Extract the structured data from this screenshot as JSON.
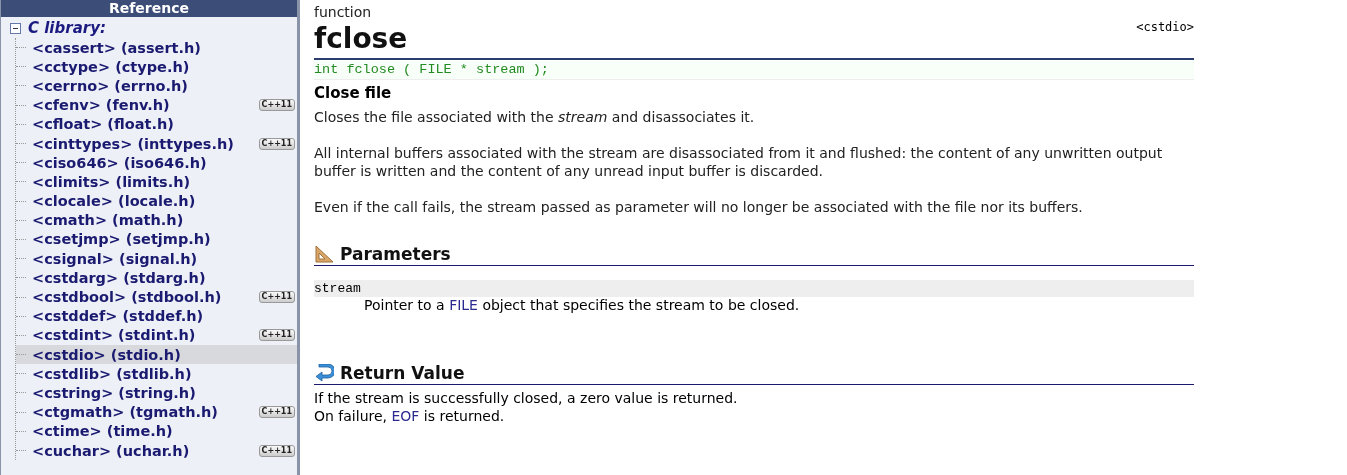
{
  "sidebar": {
    "header": "Reference",
    "section": {
      "label": "C library:",
      "expanded": true
    },
    "items": [
      {
        "label": "<cassert> (assert.h)",
        "selected": false
      },
      {
        "label": "<cctype> (ctype.h)",
        "selected": false
      },
      {
        "label": "<cerrno> (errno.h)",
        "selected": false
      },
      {
        "label": "<cfenv> (fenv.h)",
        "badge": "C++11",
        "selected": false
      },
      {
        "label": "<cfloat> (float.h)",
        "selected": false
      },
      {
        "label": "<cinttypes> (inttypes.h)",
        "badge": "C++11",
        "selected": false
      },
      {
        "label": "<ciso646> (iso646.h)",
        "selected": false
      },
      {
        "label": "<climits> (limits.h)",
        "selected": false
      },
      {
        "label": "<clocale> (locale.h)",
        "selected": false
      },
      {
        "label": "<cmath> (math.h)",
        "selected": false
      },
      {
        "label": "<csetjmp> (setjmp.h)",
        "selected": false
      },
      {
        "label": "<csignal> (signal.h)",
        "selected": false
      },
      {
        "label": "<cstdarg> (stdarg.h)",
        "selected": false
      },
      {
        "label": "<cstdbool> (stdbool.h)",
        "badge": "C++11",
        "selected": false
      },
      {
        "label": "<cstddef> (stddef.h)",
        "selected": false
      },
      {
        "label": "<cstdint> (stdint.h)",
        "badge": "C++11",
        "selected": false
      },
      {
        "label": "<cstdio> (stdio.h)",
        "selected": true
      },
      {
        "label": "<cstdlib> (stdlib.h)",
        "selected": false
      },
      {
        "label": "<cstring> (string.h)",
        "selected": false
      },
      {
        "label": "<ctgmath> (tgmath.h)",
        "badge": "C++11",
        "selected": false
      },
      {
        "label": "<ctime> (time.h)",
        "selected": false
      },
      {
        "label": "<cuchar> (uchar.h)",
        "badge": "C++11",
        "selected": false
      }
    ]
  },
  "article": {
    "kind_label": "function",
    "title": "fclose",
    "header": "<cstdio>",
    "prototype": "int fclose ( FILE * stream );",
    "subtitle": "Close file",
    "paragraphs": [
      "Closes the file associated with the *stream* and disassociates it.",
      "All internal buffers associated with the stream are disassociated from it and flushed: the content of any unwritten output buffer is written and the content of any unread input buffer is discarded.",
      "Even if the call fails, the stream passed as parameter will no longer be associated with the file nor its buffers."
    ],
    "parameters_heading": "Parameters",
    "parameters": [
      {
        "name": "stream",
        "before": "Pointer to a ",
        "link": "FILE",
        "after": " object that specifies the stream to be closed."
      }
    ],
    "return_heading": "Return Value",
    "return_lines": [
      {
        "before": "If the stream is successfully closed, a zero value is returned."
      },
      {
        "before": "On failure, ",
        "link": "EOF",
        "after": " is returned."
      }
    ]
  }
}
